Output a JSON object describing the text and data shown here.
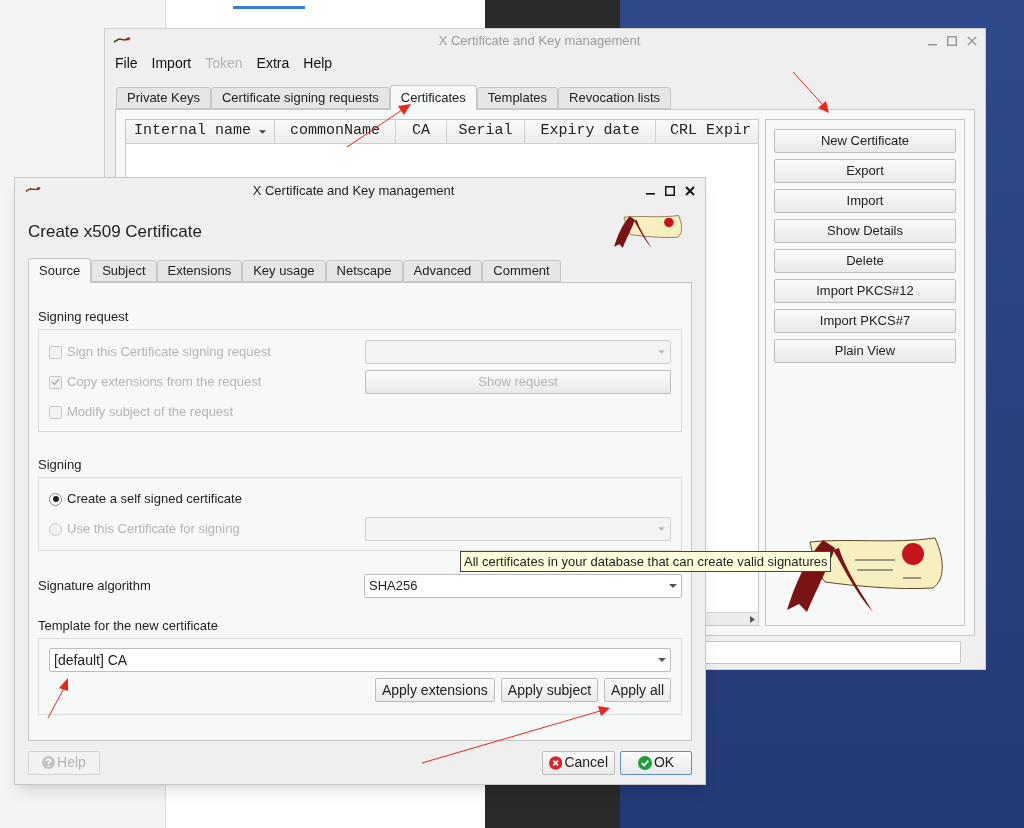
{
  "main_window": {
    "title": "X Certificate and Key management",
    "menu": [
      {
        "label": "File",
        "disabled": false
      },
      {
        "label": "Import",
        "disabled": false
      },
      {
        "label": "Token",
        "disabled": true
      },
      {
        "label": "Extra",
        "disabled": false
      },
      {
        "label": "Help",
        "disabled": false
      }
    ],
    "tabs": [
      {
        "label": "Private Keys",
        "selected": false
      },
      {
        "label": "Certificate signing requests",
        "selected": false
      },
      {
        "label": "Certificates",
        "selected": true
      },
      {
        "label": "Templates",
        "selected": false
      },
      {
        "label": "Revocation lists",
        "selected": false
      }
    ],
    "table": {
      "columns": [
        {
          "label": "Internal name",
          "sorted": true
        },
        {
          "label": "commonName",
          "sorted": false
        },
        {
          "label": "CA",
          "sorted": false
        },
        {
          "label": "Serial",
          "sorted": false
        },
        {
          "label": "Expiry date",
          "sorted": false
        },
        {
          "label": "CRL Expir",
          "sorted": false
        }
      ]
    },
    "buttons": [
      "New Certificate",
      "Export",
      "Import",
      "Show Details",
      "Delete",
      "Import PKCS#12",
      "Import PKCS#7",
      "Plain View"
    ]
  },
  "dialog": {
    "title": "X Certificate and Key management",
    "heading": "Create x509 Certificate",
    "tabs": [
      {
        "label": "Source",
        "selected": true
      },
      {
        "label": "Subject",
        "selected": false
      },
      {
        "label": "Extensions",
        "selected": false
      },
      {
        "label": "Key usage",
        "selected": false
      },
      {
        "label": "Netscape",
        "selected": false
      },
      {
        "label": "Advanced",
        "selected": false
      },
      {
        "label": "Comment",
        "selected": false
      }
    ],
    "signing_request": {
      "title": "Signing request",
      "options": [
        {
          "label": "Sign this Certificate signing request",
          "checked": false,
          "disabled": true,
          "control": {
            "kind": "dropdown",
            "disabled": true
          }
        },
        {
          "label": "Copy extensions from the request",
          "checked": true,
          "disabled": true,
          "control": {
            "kind": "button",
            "label": "Show request",
            "disabled": true
          }
        },
        {
          "label": "Modify subject of the request",
          "checked": false,
          "disabled": true
        }
      ]
    },
    "signing": {
      "title": "Signing",
      "options": [
        {
          "label": "Create a self signed certificate",
          "selected": true,
          "disabled": false
        },
        {
          "label": "Use this Certificate for signing",
          "selected": false,
          "disabled": true,
          "control": {
            "kind": "dropdown",
            "disabled": true
          }
        }
      ]
    },
    "signature_algorithm": {
      "label": "Signature algorithm",
      "value": "SHA256"
    },
    "template": {
      "title": "Template for the new certificate",
      "value": "[default] CA",
      "buttons": [
        "Apply extensions",
        "Apply subject",
        "Apply all"
      ]
    },
    "buttons": [
      {
        "label": "Help",
        "kind": "help",
        "disabled": true
      },
      {
        "label": "Cancel",
        "kind": "cancel",
        "disabled": false
      },
      {
        "label": "OK",
        "kind": "ok",
        "disabled": false
      }
    ]
  },
  "tooltip": "All certificates in your database that can create valid signatures"
}
